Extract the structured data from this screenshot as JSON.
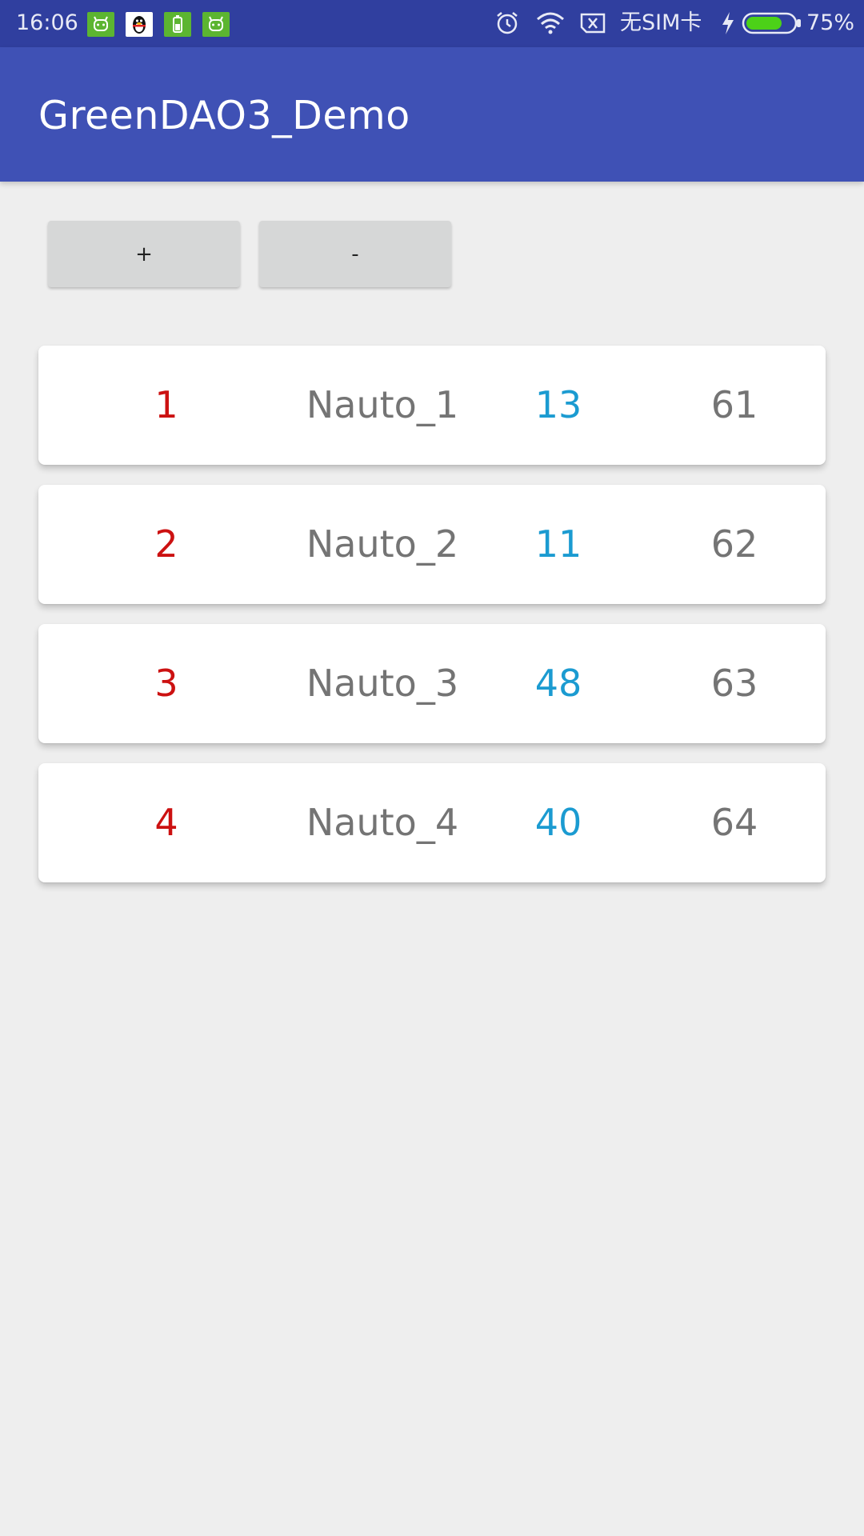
{
  "status_bar": {
    "time": "16:06",
    "sim_text": "无SIM卡",
    "battery_percent": "75%",
    "battery_level": 0.75,
    "notification_icons": [
      "android-app-icon",
      "qq-penguin-icon",
      "battery-app-icon",
      "android-app-icon"
    ],
    "system_icons": [
      "alarm-icon",
      "wifi-icon",
      "no-sim-icon",
      "charging-icon",
      "battery-icon"
    ],
    "colors": {
      "background": "#303f9f",
      "battery_fill": "#4cd118"
    }
  },
  "app_bar": {
    "title": "GreenDAO3_Demo",
    "color": "#3f51b5"
  },
  "actions": {
    "add_label": "+",
    "remove_label": "-"
  },
  "list": {
    "items": [
      {
        "id": "1",
        "name": "Nauto_1",
        "age": "13",
        "extra": "61"
      },
      {
        "id": "2",
        "name": "Nauto_2",
        "age": "11",
        "extra": "62"
      },
      {
        "id": "3",
        "name": "Nauto_3",
        "age": "48",
        "extra": "63"
      },
      {
        "id": "4",
        "name": "Nauto_4",
        "age": "40",
        "extra": "64"
      }
    ],
    "colors": {
      "id": "#cc1111",
      "name": "#747474",
      "age": "#1b9bd1",
      "extra": "#747474"
    }
  }
}
